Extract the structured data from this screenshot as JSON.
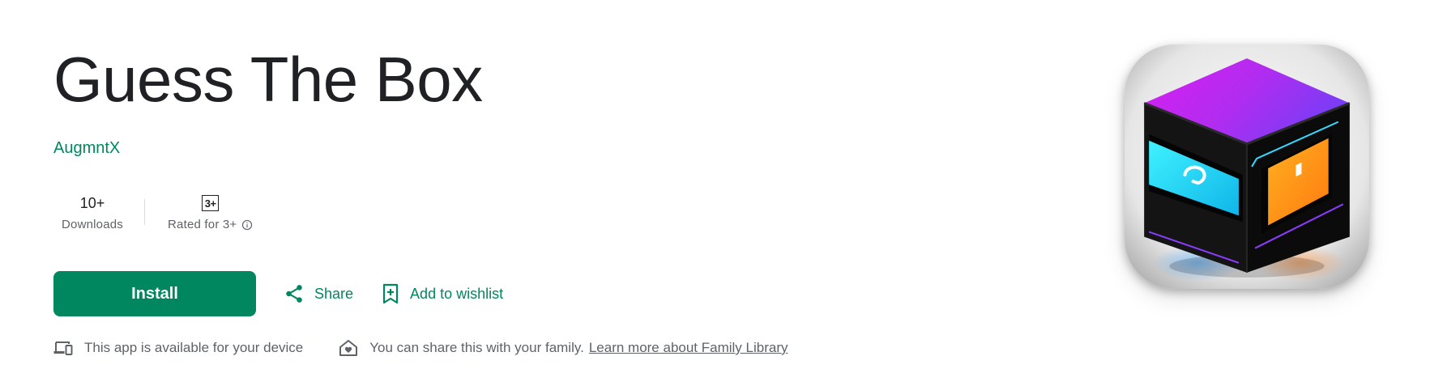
{
  "app": {
    "title": "Guess The Box",
    "developer": "AugmntX"
  },
  "stats": {
    "downloads_value": "10+",
    "downloads_label": "Downloads",
    "rating_badge": "3+",
    "rating_label": "Rated for 3+"
  },
  "actions": {
    "install_label": "Install",
    "share_label": "Share",
    "wishlist_label": "Add to wishlist"
  },
  "footer": {
    "device_text": "This app is available for your device",
    "family_text": "You can share this with your family.",
    "family_link": "Learn more about Family Library"
  },
  "icons": [
    "devices-icon",
    "family-home-icon",
    "share-icon",
    "bookmark-add-icon",
    "info-icon"
  ],
  "colors": {
    "accent": "#01875f",
    "title": "#202124",
    "secondary_text": "#5f6368"
  }
}
